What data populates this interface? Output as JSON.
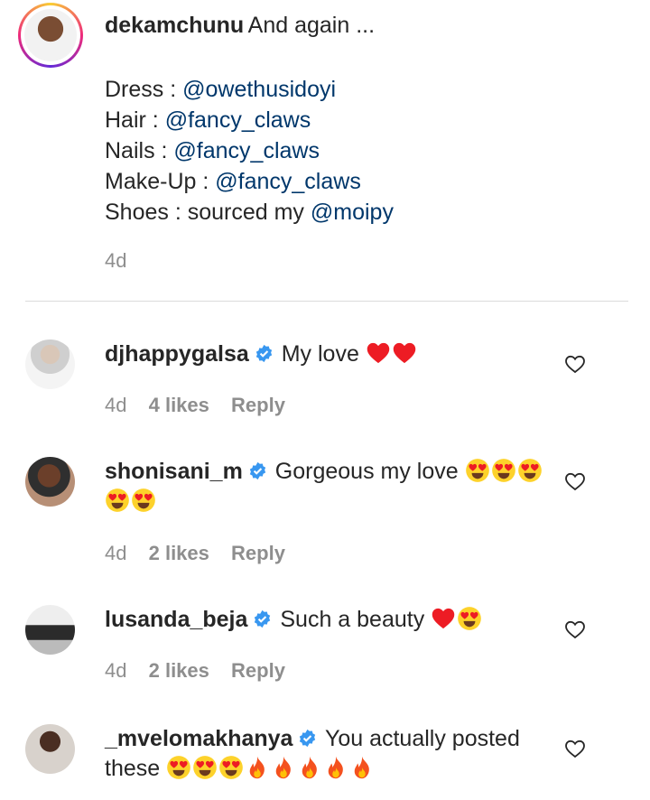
{
  "caption": {
    "username": "dekamchunu",
    "text": "And again ...",
    "credits": [
      {
        "label": "Dress : ",
        "mention": "@owethusidoyi"
      },
      {
        "label": "Hair : ",
        "mention": "@fancy_claws"
      },
      {
        "label": "Nails : ",
        "mention": "@fancy_claws"
      },
      {
        "label": "Make-Up : ",
        "mention": "@fancy_claws"
      },
      {
        "label": "Shoes : sourced my ",
        "mention": "@moipy"
      }
    ],
    "time": "4d"
  },
  "comments": [
    {
      "username": "djhappygalsa",
      "text": "My love",
      "emojis": [
        "heart",
        "heart"
      ],
      "time": "4d",
      "likes": "4 likes",
      "reply": "Reply"
    },
    {
      "username": "shonisani_m",
      "text": "Gorgeous my love",
      "emojis": [
        "heart-eyes",
        "heart-eyes",
        "heart-eyes",
        "heart-eyes",
        "heart-eyes"
      ],
      "time": "4d",
      "likes": "2 likes",
      "reply": "Reply"
    },
    {
      "username": "lusanda_beja",
      "text": "Such a beauty",
      "emojis": [
        "heart",
        "heart-eyes"
      ],
      "time": "4d",
      "likes": "2 likes",
      "reply": "Reply"
    },
    {
      "username": "_mvelomakhanya",
      "text": "You actually posted these",
      "emojis": [
        "heart-eyes",
        "heart-eyes",
        "heart-eyes",
        "fire",
        "fire",
        "fire",
        "fire",
        "fire"
      ],
      "time": "",
      "likes": "",
      "reply": ""
    }
  ],
  "colors": {
    "mention": "#00376b",
    "verified": "#3897f0",
    "muted": "#8e8e8e",
    "heart": "#ed1c24"
  }
}
